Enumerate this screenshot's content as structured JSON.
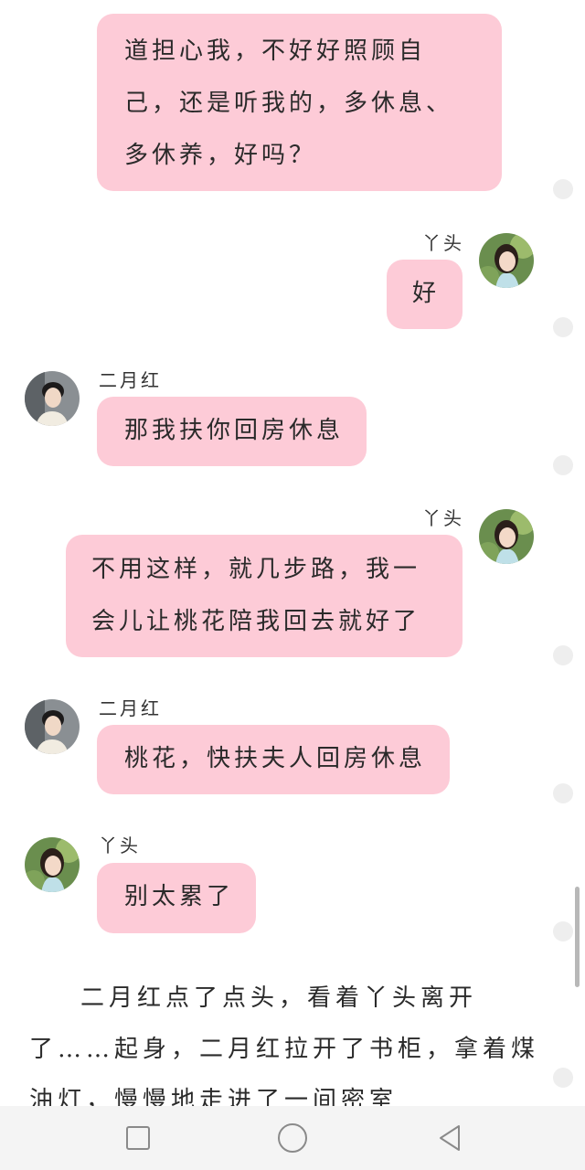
{
  "messages": [
    {
      "side": "left",
      "sender": "",
      "text": "道担心我，不好好照顾自\n己，还是听我的，多休息、\n多休养，好吗？"
    },
    {
      "side": "right",
      "sender": "丫头",
      "text": "好"
    },
    {
      "side": "left",
      "sender": "二月红",
      "text": "那我扶你回房休息"
    },
    {
      "side": "right",
      "sender": "丫头",
      "text": "不用这样，就几步路，我一\n会儿让桃花陪我回去就好了"
    },
    {
      "side": "left",
      "sender": "二月红",
      "text": "桃花，快扶夫人回房休息"
    },
    {
      "side": "left",
      "sender": "丫头",
      "text": "别太累了"
    }
  ],
  "narration": "二月红点了点头，看着丫头离开了……起身，二月红拉开了书柜，拿着煤油灯，慢慢地走进了一间密室",
  "colors": {
    "bubble": "#fdcbd7",
    "navbar": "#f4f4f4",
    "read_dot": "#eeeeee"
  },
  "icons": {
    "avatar_yatou": "woman-avatar-icon",
    "avatar_eryuehong": "man-avatar-icon",
    "nav_recent": "square-icon",
    "nav_home": "circle-icon",
    "nav_back": "triangle-back-icon"
  }
}
